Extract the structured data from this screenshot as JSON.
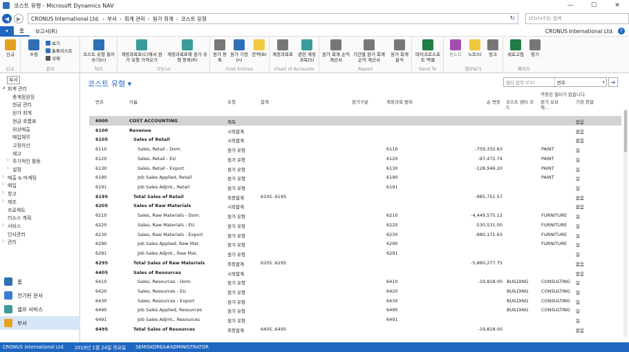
{
  "window": {
    "title": "코스트 유형 - Microsoft Dynamics NAV"
  },
  "address": {
    "crumbs": [
      "CRONUS International Ltd.",
      "부서",
      "회계 관리",
      "원가 회계",
      "코스트 유형"
    ],
    "search_placeholder": "(Ctrl+F3) 검색"
  },
  "ribbon_tabs": {
    "home": "홈",
    "report": "보고서(R)"
  },
  "company": "CRONUS International Ltd.",
  "ribbon": {
    "new": {
      "label": "신규",
      "group": "신규"
    },
    "manage": {
      "group": "관리",
      "edit": "수정",
      "view": "보기",
      "edit_list": "통류리스트",
      "delete": "삭제"
    },
    "process": {
      "group": "처리",
      "insert_cost_types": "코스트 유형 들어쓰기(n)"
    },
    "function": {
      "group": "기능(u)",
      "get_gl": "계정과목표(C)에서 원가 유형 가져오기",
      "update_gl": "계정과목표에 원가 유형 등록(R)"
    },
    "entries": {
      "group": "Cost Entries",
      "cost_register": "원가 등록",
      "cost_period": "원가 기장(n)",
      "balance": "잔액(B)"
    },
    "coa": {
      "group": "Chart of Accounts",
      "coa": "계정과목표",
      "related": "관련 계정 과목(S)"
    },
    "report": {
      "group": "Report",
      "acct_details": "원가 회계 손익 계산서",
      "acct_by_period": "기간별 원가 회계 손익 계산서",
      "acct_analysis": "원가 회계 분석"
    },
    "send": {
      "group": "Send To",
      "excel": "마이크로소프트 엑셀"
    },
    "attach": {
      "group": "첨부보기",
      "onenote": "원노트",
      "notes": "노트(t)",
      "links": "링크"
    },
    "page": {
      "group": "페이지",
      "refresh": "새로고침",
      "find": "찾기"
    }
  },
  "sidebar": {
    "root": "부서",
    "items": [
      {
        "label": "회계 관리",
        "level": 1,
        "tri": "◢"
      },
      {
        "label": "총계정원장",
        "level": 2
      },
      {
        "label": "현금 관리",
        "level": 2
      },
      {
        "label": "원가 회계",
        "level": 2
      },
      {
        "label": "현금 흐름표",
        "level": 2
      },
      {
        "label": "외상매출",
        "level": 2
      },
      {
        "label": "매입채무",
        "level": 2
      },
      {
        "label": "고정자산",
        "level": 2
      },
      {
        "label": "재고",
        "level": 2
      },
      {
        "label": "주기적인 활동",
        "level": 2,
        "tri": "▷"
      },
      {
        "label": "설정",
        "level": 2,
        "tri": "▷"
      },
      {
        "label": "매출 & 마케팅",
        "level": 1,
        "tri": "▷"
      },
      {
        "label": "매입",
        "level": 1,
        "tri": "▷"
      },
      {
        "label": "창고",
        "level": 1,
        "tri": "▷"
      },
      {
        "label": "제조",
        "level": 1,
        "tri": "▷"
      },
      {
        "label": "프로젝트",
        "level": 1
      },
      {
        "label": "리소스 계획",
        "level": 1
      },
      {
        "label": "서비스",
        "level": 1,
        "tri": "▷"
      },
      {
        "label": "인사관리",
        "level": 1
      },
      {
        "label": "관리",
        "level": 1,
        "tri": "▷"
      }
    ],
    "panes": [
      {
        "label": "홈",
        "color": "#2e6fb6"
      },
      {
        "label": "전기된 문서",
        "color": "#3a7bd5"
      },
      {
        "label": "셀프 서비스",
        "color": "#3a9b9b"
      },
      {
        "label": "부서",
        "color": "#e6a020"
      }
    ]
  },
  "page": {
    "title": "코스트 유형 ▾",
    "filter_placeholder": "필터 입력 (F3)",
    "filter_field": "번호",
    "filter_note": "적용된 필터가 없습니다."
  },
  "columns": {
    "no": "번호",
    "name": "이름",
    "type": "유형",
    "totaling": "합계",
    "class": "원가구분",
    "gl_range": "계정과목 범위",
    "net_change": "순 변동",
    "cost_center": "코스트 센터 코드",
    "cost_object": "원가 오브젝...",
    "posting": "기장 종합"
  },
  "rows": [
    {
      "no": "6000",
      "name": "COST ACCOUNTING",
      "type": "제목",
      "tot": "",
      "gl": "",
      "net": "",
      "cc": "",
      "co": "",
      "post": "없음",
      "bold": true,
      "indent": 0
    },
    {
      "no": "6100",
      "name": "Revenue",
      "type": "시작합계",
      "tot": "",
      "gl": "",
      "net": "",
      "cc": "",
      "co": "",
      "post": "없음",
      "bold": true,
      "indent": 0
    },
    {
      "no": "6105",
      "name": "Sales of Retail",
      "type": "시작합계",
      "tot": "",
      "gl": "",
      "net": "",
      "cc": "",
      "co": "",
      "post": "없음",
      "bold": true,
      "indent": 1
    },
    {
      "no": "6110",
      "name": "Sales, Retail - Dom.",
      "type": "원가 유형",
      "tot": "",
      "gl": "6110",
      "net": "-759,332.63",
      "cc": "",
      "co": "PAINT",
      "post": "일",
      "bold": false,
      "indent": 2
    },
    {
      "no": "6120",
      "name": "Sales, Retail - EU",
      "type": "원가 유형",
      "tot": "",
      "gl": "6120",
      "net": "-97,472.74",
      "cc": "",
      "co": "PAINT",
      "post": "일",
      "bold": false,
      "indent": 2
    },
    {
      "no": "6130",
      "name": "Sales, Retail - Export",
      "type": "원가 유형",
      "tot": "",
      "gl": "6130",
      "net": "-128,946.20",
      "cc": "",
      "co": "PAINT",
      "post": "일",
      "bold": false,
      "indent": 2
    },
    {
      "no": "6190",
      "name": "Job Sales Applied, Retail",
      "type": "원가 유형",
      "tot": "",
      "gl": "6190",
      "net": "",
      "cc": "",
      "co": "PAINT",
      "post": "일",
      "bold": false,
      "indent": 2
    },
    {
      "no": "6191",
      "name": "Job Sales Adjmt., Retail",
      "type": "원가 유형",
      "tot": "",
      "gl": "6191",
      "net": "",
      "cc": "",
      "co": "",
      "post": "일",
      "bold": false,
      "indent": 2
    },
    {
      "no": "6195",
      "name": "Total Sales of Retail",
      "type": "최종합계",
      "tot": "6105..6195",
      "gl": "",
      "net": "-985,751.57",
      "cc": "",
      "co": "",
      "post": "없음",
      "bold": true,
      "indent": 1
    },
    {
      "no": "6205",
      "name": "Sales of Raw Materials",
      "type": "시작합계",
      "tot": "",
      "gl": "",
      "net": "",
      "cc": "",
      "co": "",
      "post": "없음",
      "bold": true,
      "indent": 1
    },
    {
      "no": "6210",
      "name": "Sales, Raw Materials - Dom.",
      "type": "원가 유형",
      "tot": "",
      "gl": "6210",
      "net": "-4,449,575.12",
      "cc": "",
      "co": "FURNITURE",
      "post": "일",
      "bold": false,
      "indent": 2
    },
    {
      "no": "6220",
      "name": "Sales, Raw Materials - EU",
      "type": "원가 유형",
      "tot": "",
      "gl": "6220",
      "net": "-530,531.00",
      "cc": "",
      "co": "FURNITURE",
      "post": "일",
      "bold": false,
      "indent": 2
    },
    {
      "no": "6230",
      "name": "Sales, Raw Materials - Export",
      "type": "원가 유형",
      "tot": "",
      "gl": "6230",
      "net": "-880,171.63",
      "cc": "",
      "co": "FURNITURE",
      "post": "일",
      "bold": false,
      "indent": 2
    },
    {
      "no": "6290",
      "name": "Job Sales Applied, Raw Mat.",
      "type": "원가 유형",
      "tot": "",
      "gl": "6290",
      "net": "",
      "cc": "",
      "co": "FURNITURE",
      "post": "일",
      "bold": false,
      "indent": 2
    },
    {
      "no": "6291",
      "name": "Job Sales Adjmt., Raw Mat.",
      "type": "원가 유형",
      "tot": "",
      "gl": "6291",
      "net": "",
      "cc": "",
      "co": "",
      "post": "일",
      "bold": false,
      "indent": 2
    },
    {
      "no": "6295",
      "name": "Total Sales of Raw Materials",
      "type": "최종합계",
      "tot": "6205..6295",
      "gl": "",
      "net": "-5,860,277.75",
      "cc": "",
      "co": "",
      "post": "없음",
      "bold": true,
      "indent": 1
    },
    {
      "no": "6405",
      "name": "Sales of Resources",
      "type": "시작합계",
      "tot": "",
      "gl": "",
      "net": "",
      "cc": "",
      "co": "",
      "post": "없음",
      "bold": true,
      "indent": 1
    },
    {
      "no": "6410",
      "name": "Sales, Resources - Dom.",
      "type": "원가 유형",
      "tot": "",
      "gl": "6410",
      "net": "-19,818.00",
      "cc": "BUILDING",
      "co": "CONSULTING",
      "post": "일",
      "bold": false,
      "indent": 2
    },
    {
      "no": "6420",
      "name": "Sales, Resources - EU",
      "type": "원가 유형",
      "tot": "",
      "gl": "6420",
      "net": "",
      "cc": "BUILDING",
      "co": "CONSULTING",
      "post": "일",
      "bold": false,
      "indent": 2
    },
    {
      "no": "6430",
      "name": "Sales, Resources - Export",
      "type": "원가 유형",
      "tot": "",
      "gl": "6430",
      "net": "",
      "cc": "BUILDING",
      "co": "CONSULTING",
      "post": "일",
      "bold": false,
      "indent": 2
    },
    {
      "no": "6490",
      "name": "Job Sales Applied, Resources",
      "type": "원가 유형",
      "tot": "",
      "gl": "6490",
      "net": "",
      "cc": "BUILDING",
      "co": "CONSULTING",
      "post": "일",
      "bold": false,
      "indent": 2
    },
    {
      "no": "6491",
      "name": "Job Sales Adjmt., Resources",
      "type": "원가 유형",
      "tot": "",
      "gl": "6491",
      "net": "",
      "cc": "",
      "co": "",
      "post": "일",
      "bold": false,
      "indent": 2
    },
    {
      "no": "6495",
      "name": "Total Sales of Resources",
      "type": "최종합계",
      "tot": "6405..6495",
      "gl": "",
      "net": "-19,818.00",
      "cc": "",
      "co": "",
      "post": "없음",
      "bold": true,
      "indent": 1
    }
  ],
  "status": {
    "company": "CRONUS International Ltd.",
    "date": "2019년 1월 24일 목요일",
    "user": "SEMISKOREA#ADMINISTRATOR"
  },
  "colors": {
    "accent": "#1f66c1",
    "selected_row": "#d3d3d3"
  }
}
